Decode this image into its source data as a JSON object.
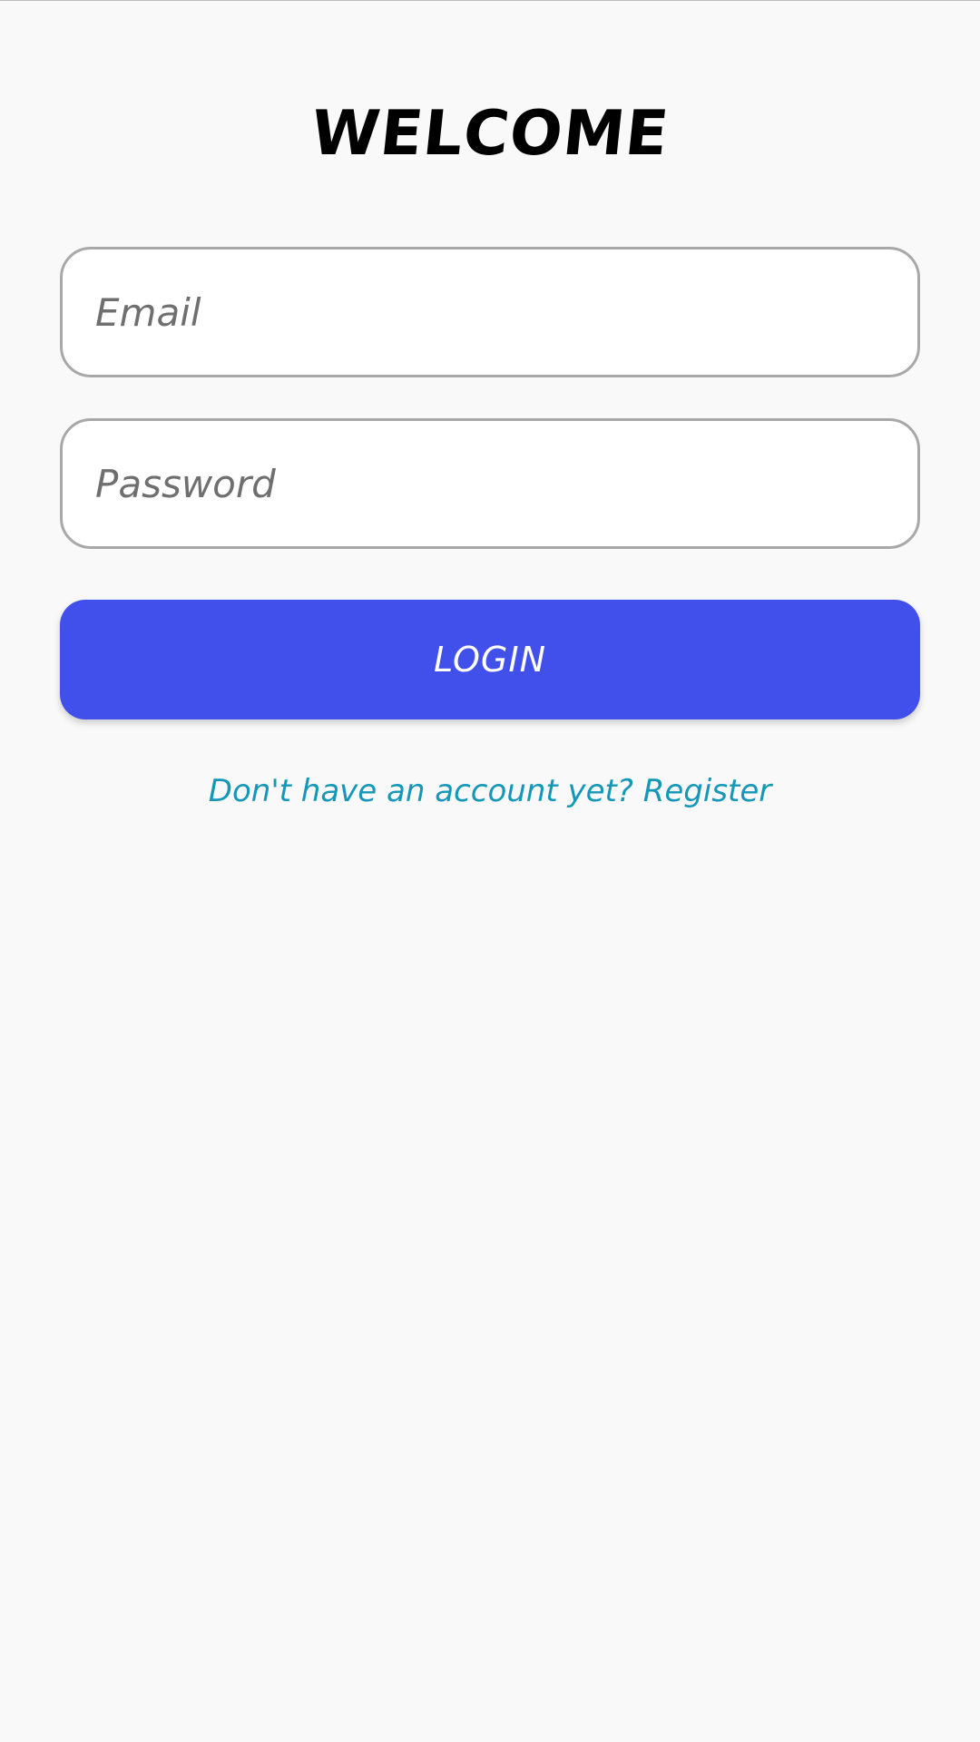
{
  "header": {
    "title": "WELCOME"
  },
  "form": {
    "email_placeholder": "Email",
    "email_value": "",
    "password_placeholder": "Password",
    "password_value": "",
    "login_label": "LOGIN",
    "register_text": "Don't have an account yet? Register"
  },
  "colors": {
    "background": "#f9f9f9",
    "accent": "#4150ea",
    "link": "#1597b8",
    "field_border": "#a8a8a8"
  }
}
